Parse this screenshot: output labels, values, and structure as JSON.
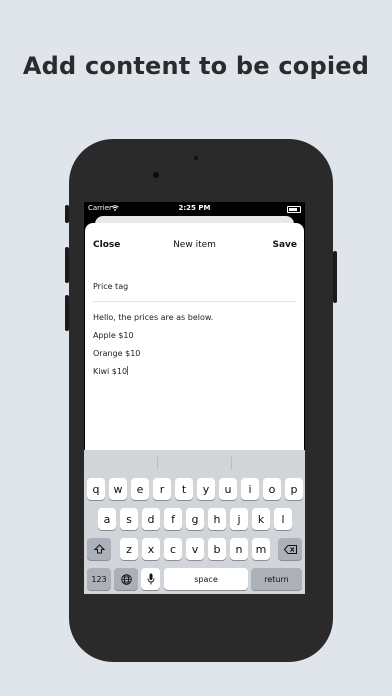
{
  "headline": "Add content to be copied",
  "status_bar": {
    "carrier": "Carrier",
    "time": "2:25 PM"
  },
  "nav": {
    "close": "Close",
    "title": "New item",
    "save": "Save"
  },
  "title_field": {
    "value": "Price tag"
  },
  "body_lines": [
    "Hello, the prices are as below.",
    "Apple $10",
    "Orange $10",
    "Kiwi $10"
  ],
  "keyboard": {
    "row1": [
      "q",
      "w",
      "e",
      "r",
      "t",
      "y",
      "u",
      "i",
      "o",
      "p"
    ],
    "row2": [
      "a",
      "s",
      "d",
      "f",
      "g",
      "h",
      "j",
      "k",
      "l"
    ],
    "row3": [
      "z",
      "x",
      "c",
      "v",
      "b",
      "n",
      "m"
    ],
    "numbers_key": "123",
    "space_key": "space",
    "return_key": "return"
  },
  "icons": [
    "wifi-icon",
    "battery-icon",
    "shift-icon",
    "backspace-icon",
    "globe-icon",
    "microphone-icon"
  ]
}
